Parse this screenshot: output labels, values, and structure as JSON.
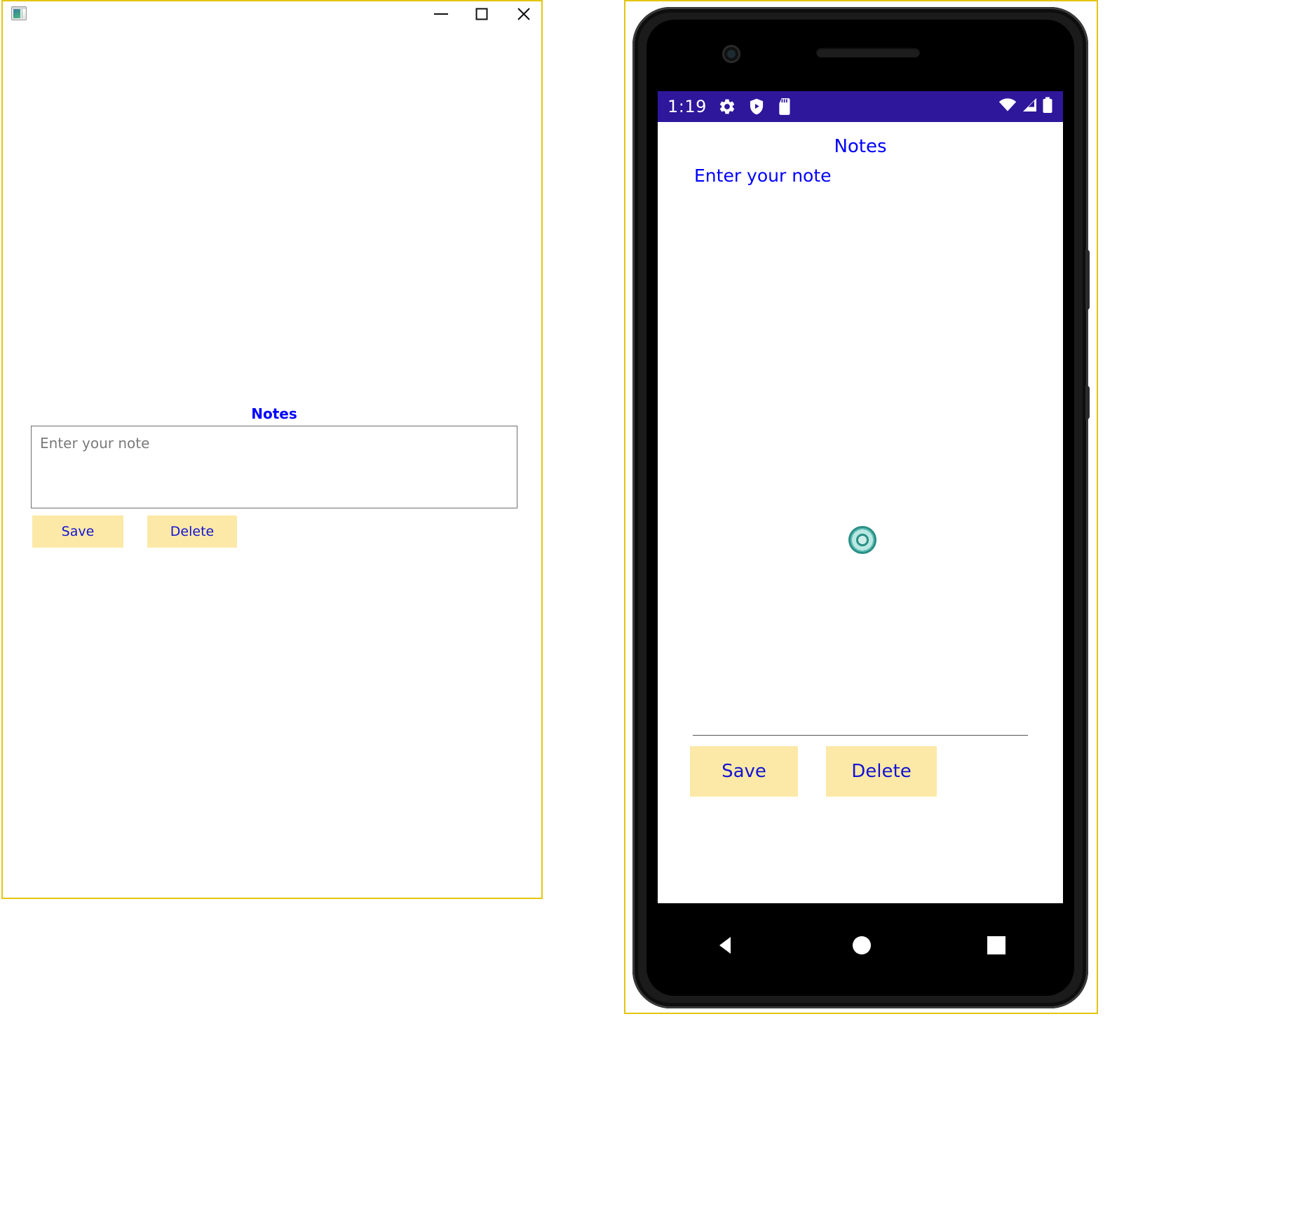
{
  "desktop": {
    "window_title": "",
    "app_icon": "window-image-icon",
    "controls": {
      "minimize": "minimize-icon",
      "maximize": "maximize-icon",
      "close": "close-icon"
    },
    "notes_title": "Notes",
    "note_placeholder": "Enter your note",
    "note_value": "",
    "save_label": "Save",
    "delete_label": "Delete"
  },
  "phone": {
    "status_bar": {
      "time": "1:19",
      "left_icons": [
        "gear-icon",
        "play-protect-shield-icon",
        "sd-card-icon"
      ],
      "right_icons": [
        "wifi-icon",
        "cellular-signal-icon",
        "battery-icon"
      ],
      "background_color": "#2e179b"
    },
    "app": {
      "notes_title": "Notes",
      "note_label": "Enter your note",
      "loading_indicator": "circular-progress-spinner",
      "save_label": "Save",
      "delete_label": "Delete"
    },
    "nav_bar": {
      "back": "back-triangle-icon",
      "home": "home-circle-icon",
      "recents": "recents-square-icon"
    }
  },
  "colors": {
    "button_bg": "#fce9a8",
    "button_text": "#1414d2",
    "title_text": "#0000ff",
    "window_border": "#e3c511",
    "status_bar": "#2e179b",
    "spinner": "#2a8f86"
  }
}
